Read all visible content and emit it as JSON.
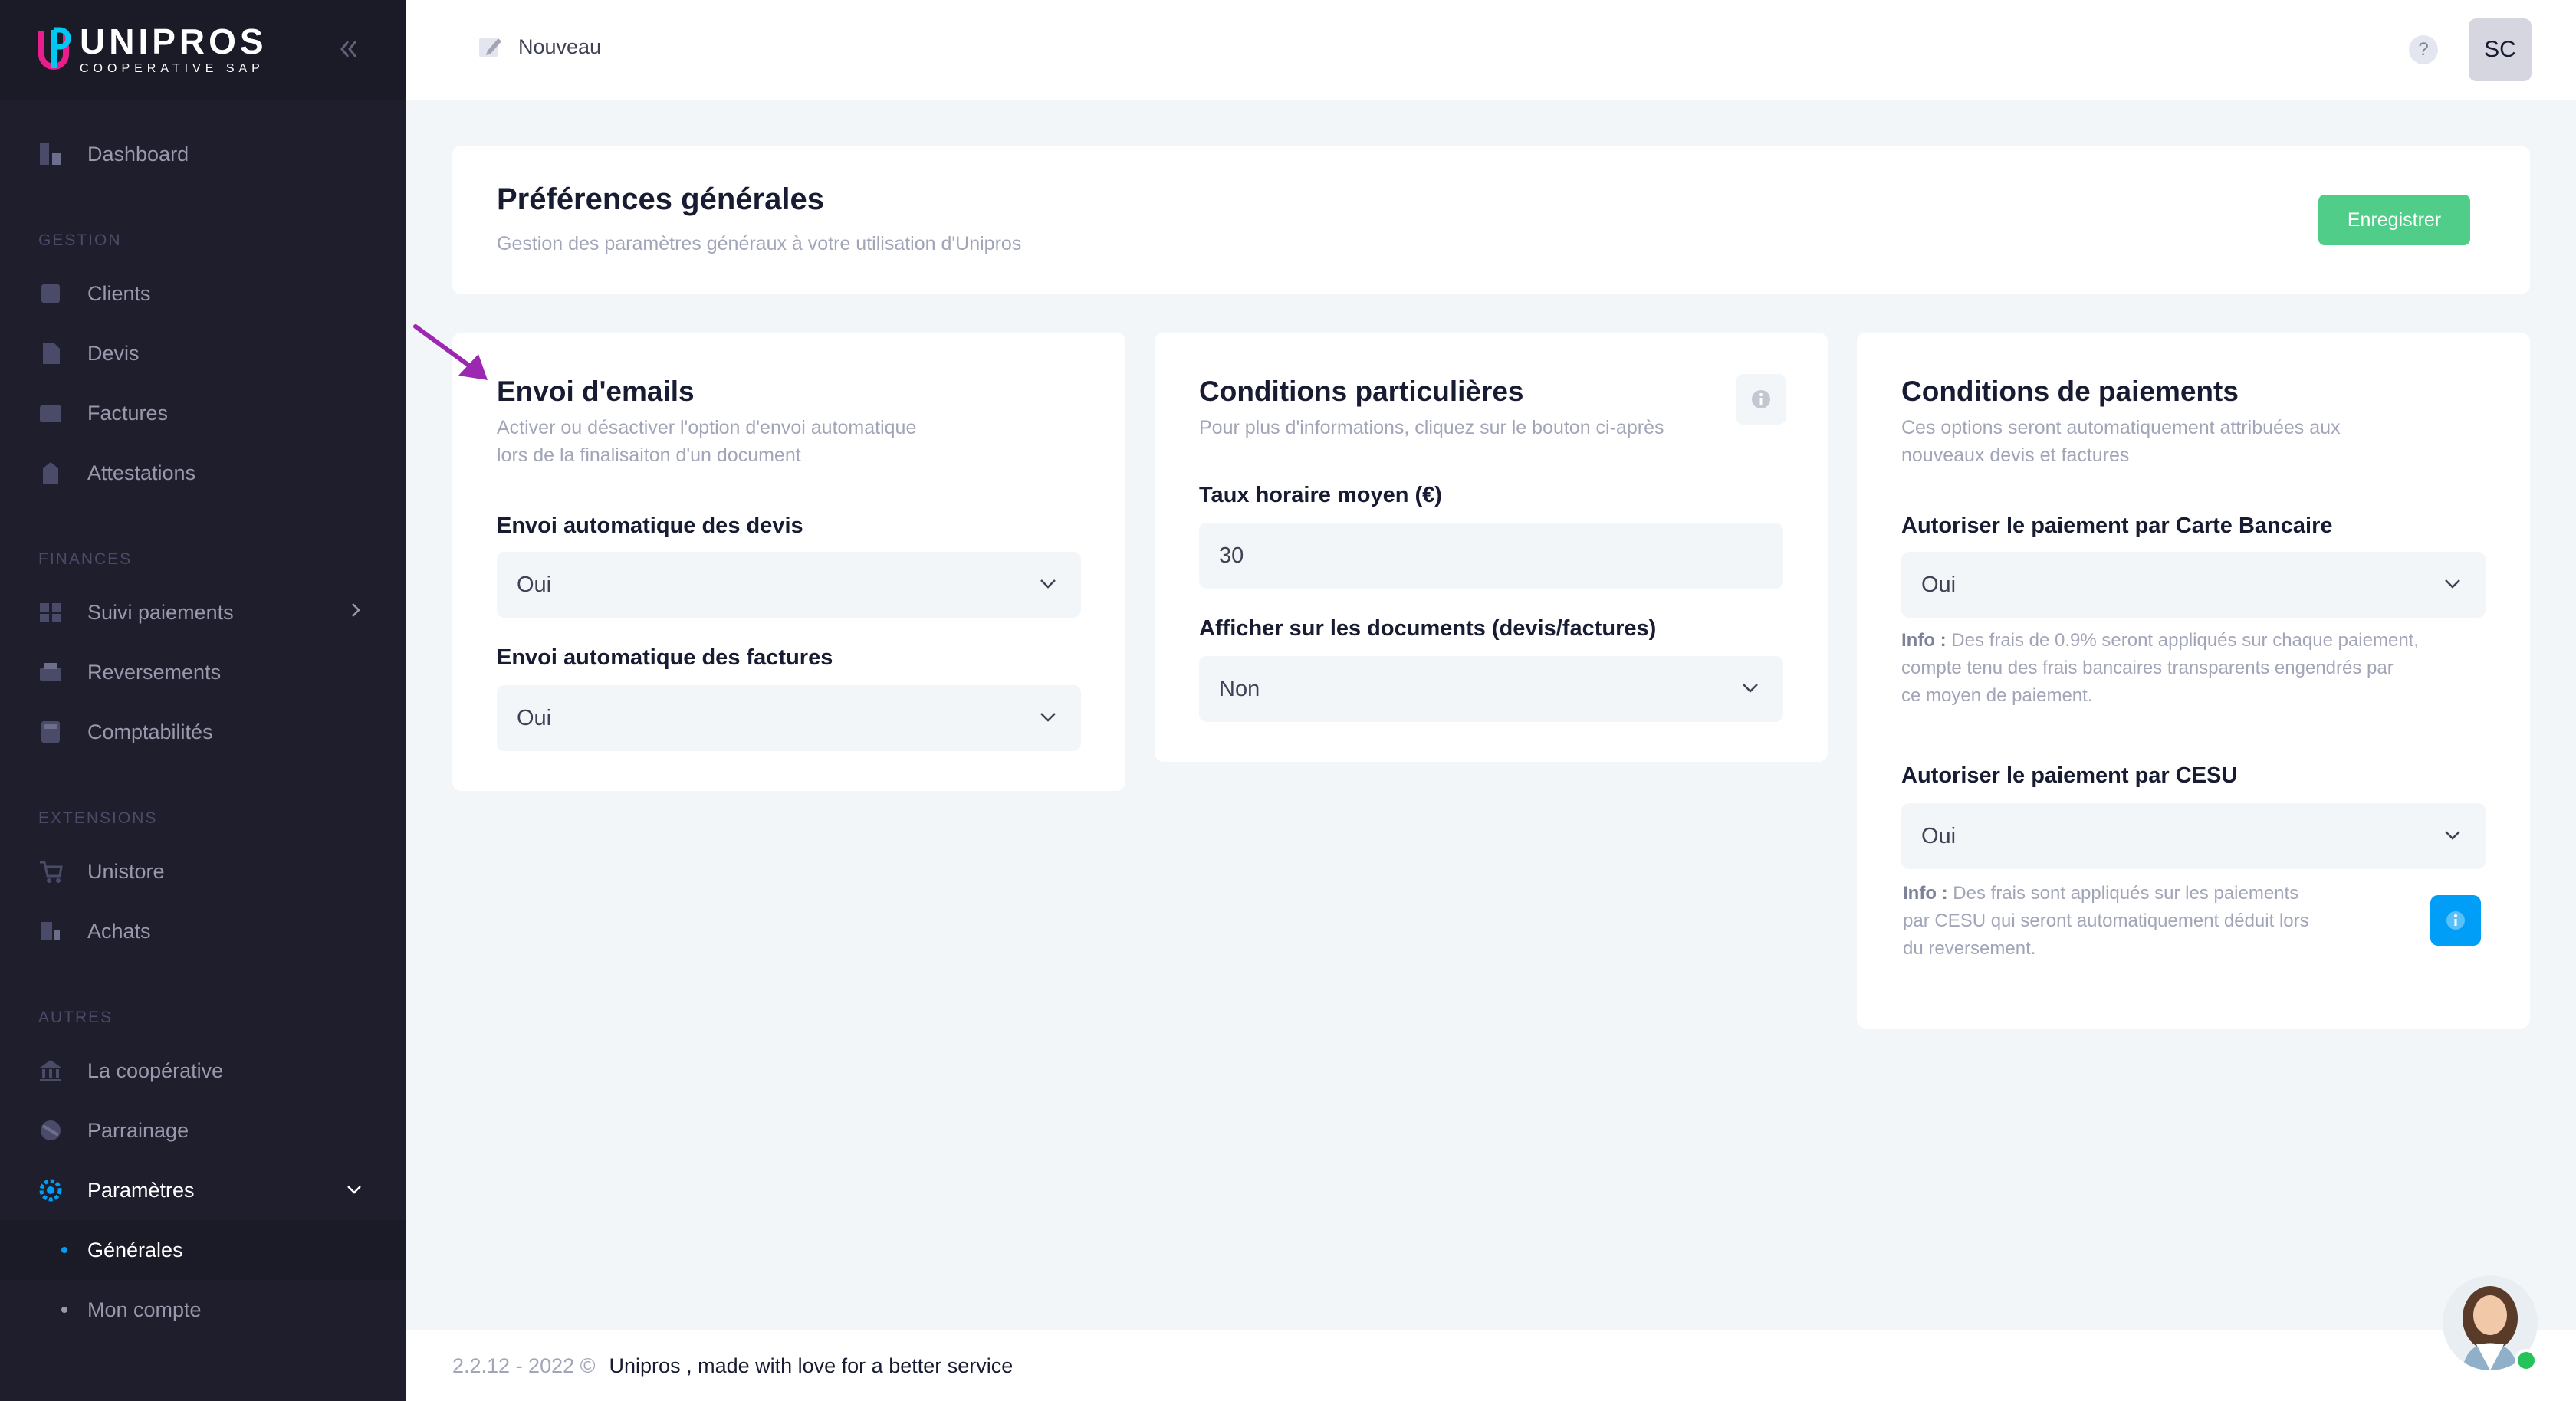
{
  "brand": {
    "name": "UNIPROS",
    "tagline": "COOPERATIVE SAP"
  },
  "sidebar": {
    "dashboard": "Dashboard",
    "sections": {
      "gestion": "GESTION",
      "finances": "FINANCES",
      "extensions": "EXTENSIONS",
      "autres": "AUTRES"
    },
    "items": {
      "clients": "Clients",
      "devis": "Devis",
      "factures": "Factures",
      "attestations": "Attestations",
      "suivi": "Suivi paiements",
      "reversements": "Reversements",
      "comptabilites": "Comptabilités",
      "unistore": "Unistore",
      "achats": "Achats",
      "cooperative": "La coopérative",
      "parrainage": "Parrainage",
      "parametres": "Paramètres"
    },
    "subitems": {
      "generales": "Générales",
      "compte": "Mon compte"
    }
  },
  "header": {
    "new_label": "Nouveau",
    "help": "?",
    "user_initials": "SC"
  },
  "prefs": {
    "title": "Préférences générales",
    "subtitle": "Gestion des paramètres généraux à votre utilisation d'Unipros",
    "save_label": "Enregistrer"
  },
  "emails": {
    "title": "Envoi d'emails",
    "subtitle_1": "Activer ou désactiver l'option d'envoi automatique",
    "subtitle_2": "lors de la finalisaiton d'un document",
    "devis_label": "Envoi automatique des devis",
    "devis_value": "Oui",
    "factures_label": "Envoi automatique des factures",
    "factures_value": "Oui"
  },
  "conditions": {
    "title": "Conditions particulières",
    "subtitle": "Pour plus d'informations, cliquez sur le bouton ci-après",
    "taux_label": "Taux horaire moyen (€)",
    "taux_value": "30",
    "afficher_label": "Afficher sur les documents (devis/factures)",
    "afficher_value": "Non"
  },
  "paiements": {
    "title": "Conditions de paiements",
    "subtitle_1": "Ces options seront automatiquement attribuées aux",
    "subtitle_2": "nouveaux devis et factures",
    "cb_label": "Autoriser le paiement par Carte Bancaire",
    "cb_value": "Oui",
    "cb_info_prefix": "Info :",
    "cb_info_1": " Des frais de 0.9% seront appliqués sur chaque paiement,",
    "cb_info_2": "compte tenu des frais bancaires transparents engendrés par",
    "cb_info_3": "ce moyen de paiement.",
    "cesu_label": "Autoriser le paiement par CESU",
    "cesu_value": "Oui",
    "cesu_info_prefix": "Info :",
    "cesu_info_1": " Des frais sont appliqués sur les paiements",
    "cesu_info_2": "par CESU qui seront automatiquement déduit lors",
    "cesu_info_3": "du reversement."
  },
  "footer": {
    "version": "2.2.12 - 2022 ©",
    "text": "Unipros , made with love for a better service"
  },
  "colors": {
    "sidebar": "#1e1e2d",
    "accent": "#009ef7",
    "success": "#50cd89",
    "annotation": "#9c27b0"
  }
}
